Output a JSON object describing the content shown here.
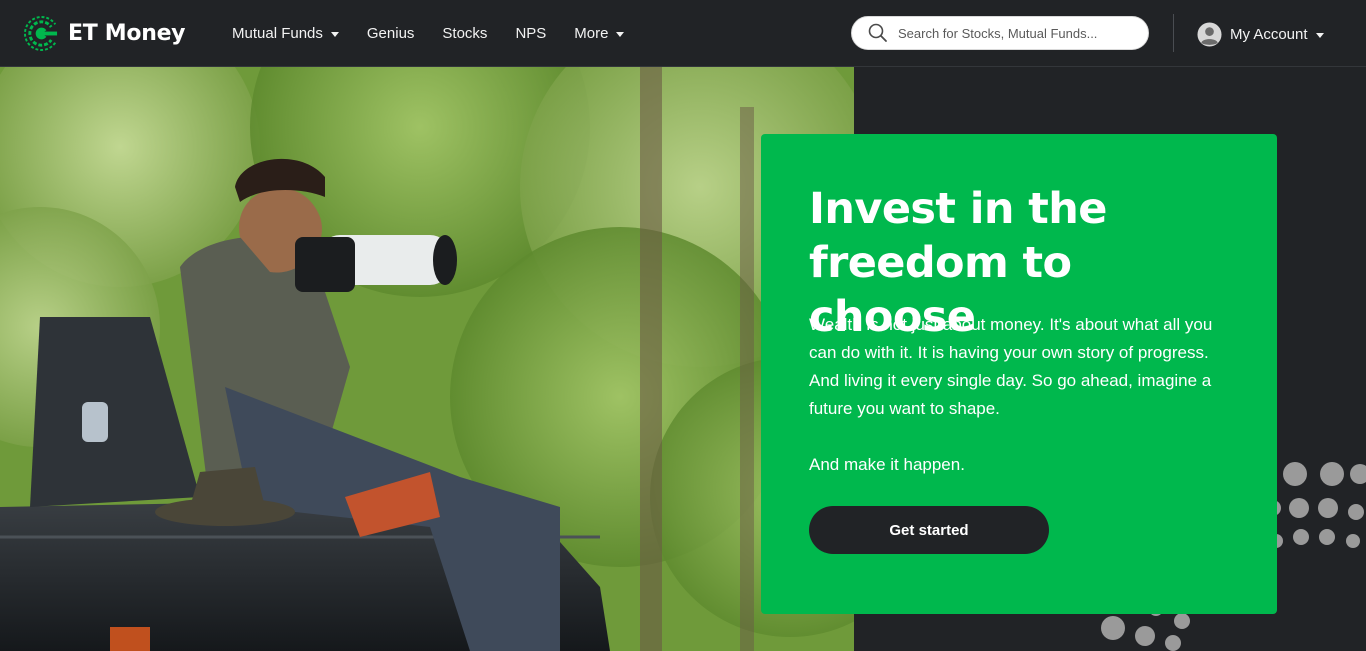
{
  "brand": {
    "name": "ET Money",
    "accent": "#00b84d",
    "dark": "#212326"
  },
  "nav": {
    "items": [
      {
        "label": "Mutual Funds",
        "dropdown": true
      },
      {
        "label": "Genius",
        "dropdown": false
      },
      {
        "label": "Stocks",
        "dropdown": false
      },
      {
        "label": "NPS",
        "dropdown": false
      },
      {
        "label": "More",
        "dropdown": true
      }
    ]
  },
  "search": {
    "placeholder": "Search for Stocks, Mutual Funds...",
    "value": "",
    "icon": "search-icon"
  },
  "account": {
    "label": "My Account",
    "icon": "user-avatar-icon"
  },
  "hero": {
    "title": "Invest in the freedom to choose",
    "body": "Wealth is not just about money. It's about what all you can do with it. It is having your own story of progress. And living it every single day. So go ahead, imagine a future you want to shape.",
    "body2": "And make it happen.",
    "cta_label": "Get started",
    "image": "photo-man-with-camera-on-jeep"
  }
}
